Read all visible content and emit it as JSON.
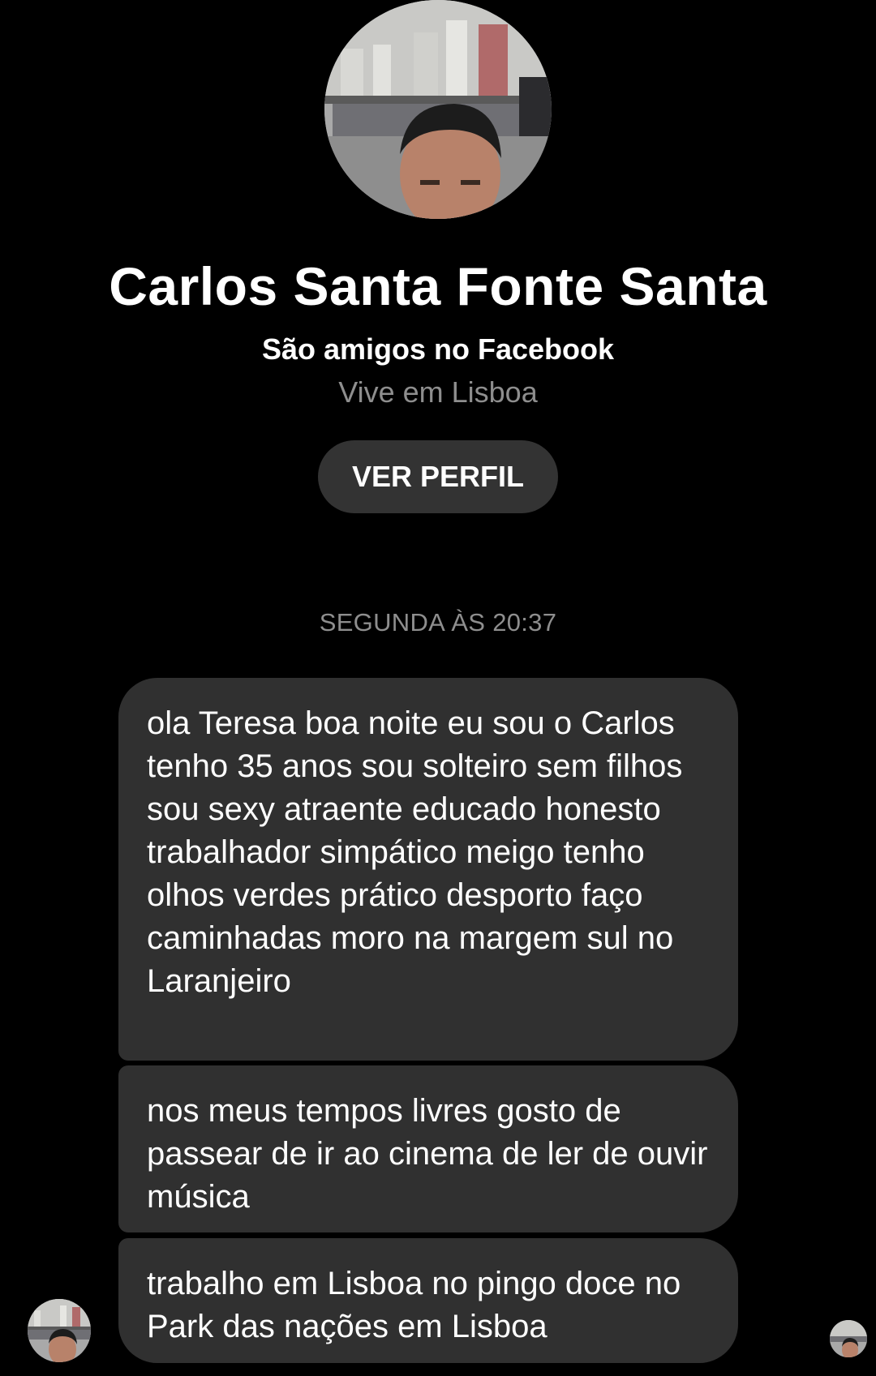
{
  "profile": {
    "name": "Carlos Santa Fonte Santa",
    "friends_note": "São amigos no Facebook",
    "location": "Vive em Lisboa",
    "view_profile_label": "VER PERFIL"
  },
  "conversation": {
    "timestamp": "SEGUNDA ÀS 20:37",
    "messages": [
      {
        "text": "ola Teresa boa noite eu sou o Carlos tenho 35 anos sou solteiro sem filhos sou sexy atraente educado honesto trabalhador simpático meigo tenho olhos verdes prático desporto faço caminhadas moro na margem sul no Laranjeiro"
      },
      {
        "text": "nos meus tempos livres gosto de passear de ir ao cinema de ler de ouvir música"
      },
      {
        "text": "trabalho em Lisboa no pingo doce no Park das nações em Lisboa"
      }
    ]
  },
  "icons": {
    "avatar": "profile-photo",
    "read_receipt": "seen-avatar-icon"
  },
  "colors": {
    "background": "#000000",
    "bubble": "#303030",
    "button": "#333333",
    "muted_text": "#8e8e8e",
    "text": "#ffffff"
  }
}
